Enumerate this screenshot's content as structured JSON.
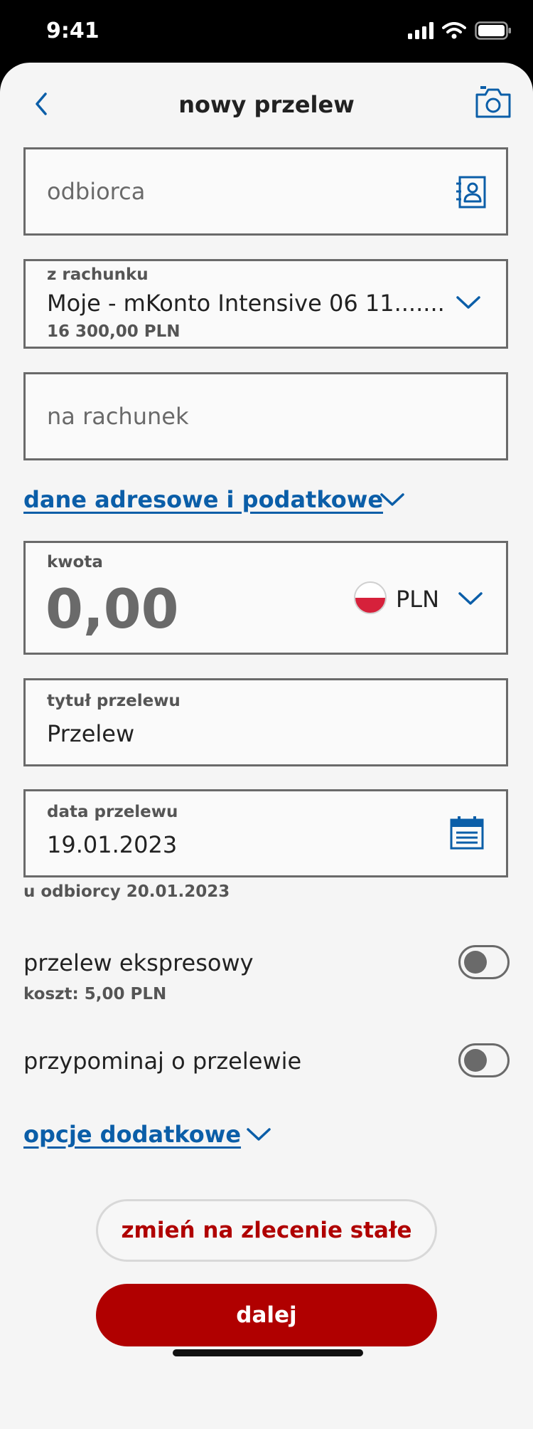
{
  "status_bar": {
    "time": "9:41"
  },
  "header": {
    "title": "nowy przelew"
  },
  "recipient": {
    "placeholder": "odbiorca"
  },
  "from_account": {
    "label": "z rachunku",
    "value": "Moje - mKonto Intensive 06 11.......",
    "balance": "16 300,00 PLN"
  },
  "to_account": {
    "placeholder": "na rachunek"
  },
  "address_link": {
    "label": "dane adresowe i podatkowe"
  },
  "amount": {
    "label": "kwota",
    "value": "0,00",
    "currency": "PLN"
  },
  "title_field": {
    "label": "tytuł przelewu",
    "value": "Przelew"
  },
  "date_field": {
    "label": "data przelewu",
    "value": "19.01.2023"
  },
  "arrival_note": "u odbiorcy 20.01.2023",
  "express": {
    "label": "przelew ekspresowy",
    "cost": "koszt: 5,00 PLN",
    "enabled": false
  },
  "reminder": {
    "label": "przypominaj o przelewie",
    "enabled": false
  },
  "options_link": {
    "label": "opcje dodatkowe"
  },
  "buttons": {
    "standing_order": "zmień na zlecenie stałe",
    "next": "dalej"
  },
  "colors": {
    "accent_blue": "#0b5ea8",
    "brand_red": "#b00000",
    "border_gray": "#6a6a6a"
  },
  "icons": [
    "back-arrow-icon",
    "camera-icon",
    "contacts-book-icon",
    "chevron-down-icon",
    "poland-flag-icon",
    "calendar-icon"
  ]
}
